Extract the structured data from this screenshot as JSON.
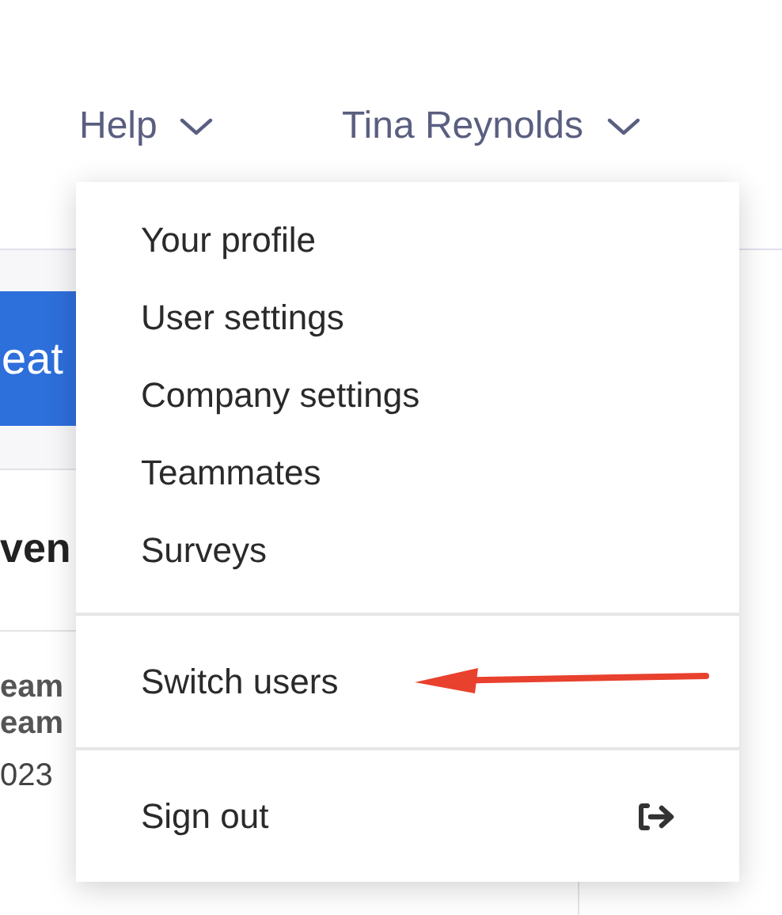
{
  "header": {
    "menus": [
      {
        "label": "Help"
      },
      {
        "label": "Tina Reynolds"
      }
    ]
  },
  "background": {
    "button_label": "eat",
    "heading": "ven",
    "lines": [
      {
        "text": "eam",
        "kind": "name"
      },
      {
        "text": "eam",
        "kind": "name"
      },
      {
        "text": "023",
        "kind": "date"
      }
    ]
  },
  "dropdown": {
    "groups": [
      {
        "items": [
          {
            "label": "Your profile",
            "kind": "link"
          },
          {
            "label": "User settings",
            "kind": "link"
          },
          {
            "label": "Company settings",
            "kind": "link"
          },
          {
            "label": "Teammates",
            "kind": "link"
          },
          {
            "label": "Surveys",
            "kind": "link"
          }
        ]
      },
      {
        "items": [
          {
            "label": "Switch users",
            "kind": "link"
          }
        ]
      },
      {
        "items": [
          {
            "label": "Sign out",
            "kind": "sign-out"
          }
        ]
      }
    ]
  },
  "annotation": {
    "kind": "arrow"
  }
}
